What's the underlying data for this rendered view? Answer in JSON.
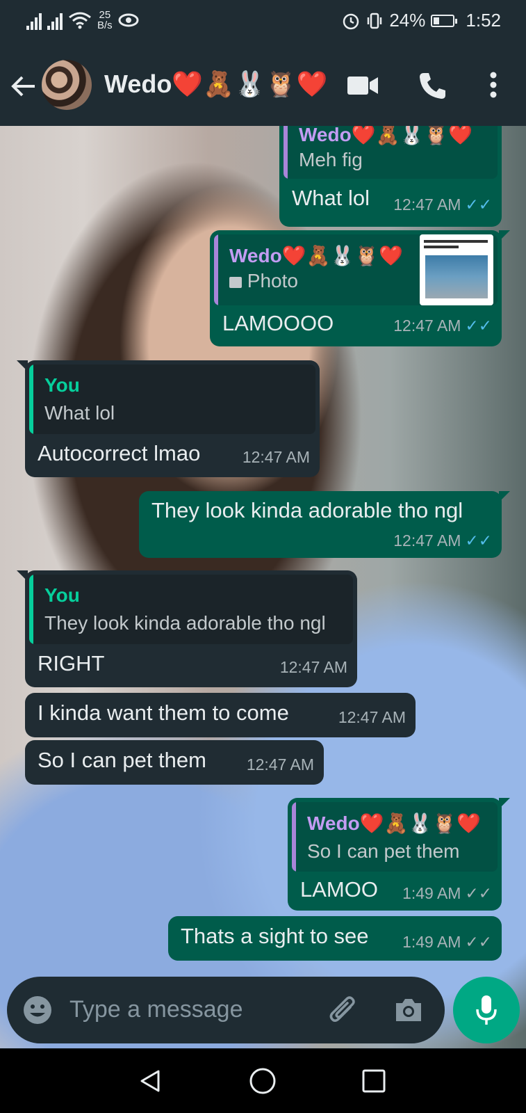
{
  "status": {
    "speed_value": "25",
    "speed_unit": "B/s",
    "battery": "24%",
    "battery_level": 0.24,
    "time": "1:52"
  },
  "header": {
    "contact_name": "Wedo❤️🧸🐰🦉❤️"
  },
  "messages": [
    {
      "direction": "out",
      "quote_author": "Wedo❤️🧸🐰🦉❤️",
      "quote_text": "Meh fig",
      "text": "What lol",
      "time": "12:47 AM"
    },
    {
      "direction": "out",
      "quote_author": "Wedo❤️🧸🐰🦉❤️",
      "quote_text": "Photo",
      "text": "LAMOOOO",
      "time": "12:47 AM"
    },
    {
      "direction": "in",
      "quote_author": "You",
      "quote_text": "What lol",
      "text": "Autocorrect lmao",
      "time": "12:47 AM"
    },
    {
      "direction": "out",
      "text": "They look kinda adorable tho ngl",
      "time": "12:47 AM"
    },
    {
      "direction": "in",
      "quote_author": "You",
      "quote_text": "They look kinda adorable tho ngl",
      "text": "RIGHT",
      "time": "12:47 AM"
    },
    {
      "direction": "in",
      "text": "I kinda want them to come",
      "time": "12:47 AM"
    },
    {
      "direction": "in",
      "text": "So I can pet them",
      "time": "12:47 AM"
    },
    {
      "direction": "out",
      "quote_author": "Wedo❤️🧸🐰🦉❤️",
      "quote_text": "So I can pet them",
      "text": "LAMOO",
      "time": "1:49 AM"
    },
    {
      "direction": "out",
      "text": "Thats a sight to see",
      "time": "1:49 AM"
    }
  ],
  "input": {
    "placeholder": "Type a message"
  },
  "colors": {
    "header_bg": "#1f2c33",
    "outgoing_bubble": "#005c4b",
    "incoming_bubble": "#202c33",
    "read_ticks": "#53bdeb",
    "delivered_ticks": "#a8b3b8",
    "mic_button": "#00a884"
  }
}
